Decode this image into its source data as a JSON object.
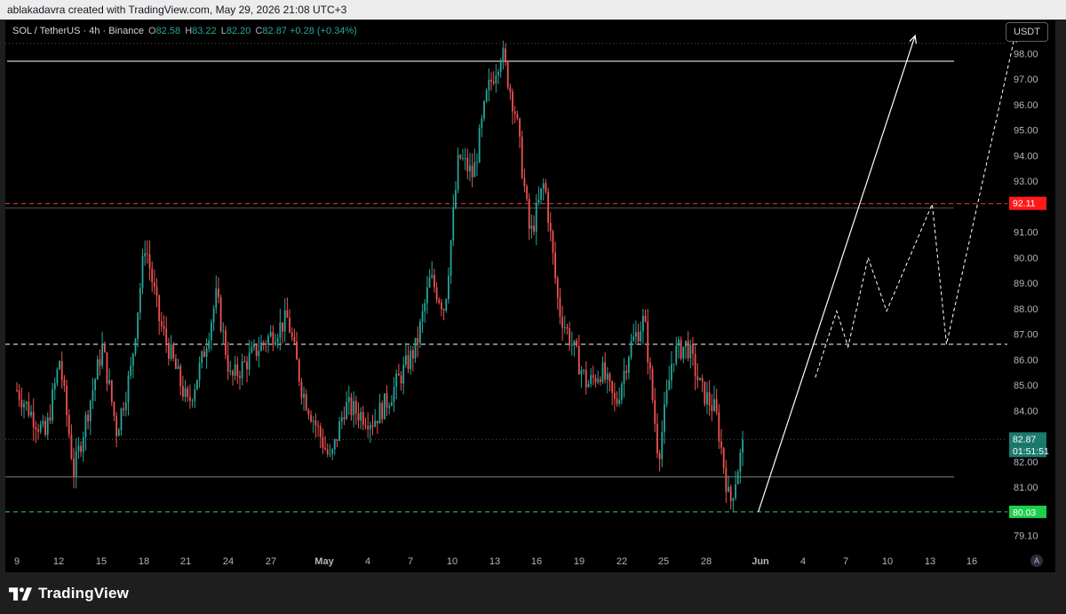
{
  "header": {
    "text": "ablakadavra created with TradingView.com, May 29, 2026 21:08 UTC+3"
  },
  "legend": {
    "symbol": "SOL / TetherUS · 4h · Binance",
    "open_label": "O",
    "open": "82.58",
    "high_label": "H",
    "high": "83.22",
    "low_label": "L",
    "low": "82.20",
    "close_label": "C",
    "close": "82.87",
    "change": "+0.28 (+0.34%)"
  },
  "currency_button": "USDT",
  "auto_scale_button": "A",
  "footer": {
    "brand": "TradingView"
  },
  "colors": {
    "up": "#26a69a",
    "down": "#ef5350",
    "background": "#000000",
    "axis_text": "#b2b5be",
    "resistance": "#ff3333",
    "support": "#39d353"
  },
  "chart_data": {
    "type": "candlestick",
    "title": "SOL / TetherUS · 4h · Binance",
    "xlabel": "",
    "ylabel": "",
    "ylim": [
      78.6,
      99.3
    ],
    "y_ticks": [
      "98.00",
      "97.00",
      "96.00",
      "95.00",
      "94.00",
      "93.00",
      "91.00",
      "90.00",
      "89.00",
      "88.00",
      "87.00",
      "86.00",
      "85.00",
      "84.00",
      "82.00",
      "81.00",
      "80.00",
      "79.10"
    ],
    "x_ticks": [
      "9",
      "12",
      "15",
      "18",
      "21",
      "24",
      "27",
      "May",
      "4",
      "7",
      "10",
      "13",
      "16",
      "19",
      "22",
      "25",
      "28",
      "Jun",
      "4",
      "7",
      "10",
      "13",
      "16"
    ],
    "x_range_days": [
      "Apr 8",
      "Jun 18"
    ],
    "price_path_approx": [
      {
        "date": "Apr 8",
        "price": 84.8
      },
      {
        "date": "Apr 10",
        "price": 83.0
      },
      {
        "date": "Apr 11",
        "price": 86.0
      },
      {
        "date": "Apr 12",
        "price": 81.6
      },
      {
        "date": "Apr 14",
        "price": 86.5
      },
      {
        "date": "Apr 15",
        "price": 83.2
      },
      {
        "date": "Apr 16",
        "price": 85.6
      },
      {
        "date": "Apr 17",
        "price": 90.6
      },
      {
        "date": "Apr 18",
        "price": 87.5
      },
      {
        "date": "Apr 20",
        "price": 84.2
      },
      {
        "date": "Apr 21",
        "price": 86.0
      },
      {
        "date": "Apr 22",
        "price": 88.5
      },
      {
        "date": "Apr 23",
        "price": 85.2
      },
      {
        "date": "Apr 25",
        "price": 86.5
      },
      {
        "date": "Apr 27",
        "price": 87.6
      },
      {
        "date": "Apr 28",
        "price": 84.8
      },
      {
        "date": "Apr 30",
        "price": 82.0
      },
      {
        "date": "May 1",
        "price": 84.2
      },
      {
        "date": "May 3",
        "price": 83.6
      },
      {
        "date": "May 4",
        "price": 84.4
      },
      {
        "date": "May 6",
        "price": 86.5
      },
      {
        "date": "May 7",
        "price": 89.2
      },
      {
        "date": "May 8",
        "price": 88.0
      },
      {
        "date": "May 9",
        "price": 94.0
      },
      {
        "date": "May 10",
        "price": 93.2
      },
      {
        "date": "May 11",
        "price": 96.5
      },
      {
        "date": "May 12",
        "price": 98.1
      },
      {
        "date": "May 13",
        "price": 95.6
      },
      {
        "date": "May 14",
        "price": 90.8
      },
      {
        "date": "May 15",
        "price": 93.0
      },
      {
        "date": "May 16",
        "price": 88.0
      },
      {
        "date": "May 17",
        "price": 86.5
      },
      {
        "date": "May 18",
        "price": 85.0
      },
      {
        "date": "May 19",
        "price": 85.6
      },
      {
        "date": "May 20",
        "price": 84.2
      },
      {
        "date": "May 21",
        "price": 86.5
      },
      {
        "date": "May 22",
        "price": 87.6
      },
      {
        "date": "May 23",
        "price": 82.2
      },
      {
        "date": "May 24",
        "price": 86.2
      },
      {
        "date": "May 25",
        "price": 86.6
      },
      {
        "date": "May 26",
        "price": 84.8
      },
      {
        "date": "May 27",
        "price": 84.0
      },
      {
        "date": "May 28",
        "price": 80.3
      },
      {
        "date": "May 29",
        "price": 82.87
      }
    ],
    "horizontal_levels": [
      {
        "price": 97.7,
        "style": "solid",
        "color": "#ffffff"
      },
      {
        "price": 98.4,
        "style": "dotted",
        "color": "#555555"
      },
      {
        "price": 92.11,
        "style": "dashed",
        "color": "#ff3333"
      },
      {
        "price": 91.95,
        "style": "solid",
        "color": "#555555"
      },
      {
        "price": 86.6,
        "style": "dashed",
        "color": "#ffffff"
      },
      {
        "price": 82.87,
        "style": "dotted",
        "color": "#555555"
      },
      {
        "price": 81.4,
        "style": "solid",
        "color": "#777777"
      },
      {
        "price": 80.03,
        "style": "dashed",
        "color": "#39d353"
      }
    ],
    "projection_arrow": [
      {
        "date": "May 30",
        "price": 80.03
      },
      {
        "date": "Jun 10",
        "price": 98.7
      }
    ],
    "projection_path": [
      {
        "date": "Jun 3",
        "price": 85.3
      },
      {
        "date": "Jun 4.5",
        "price": 87.9
      },
      {
        "date": "Jun 5.3",
        "price": 86.5
      },
      {
        "date": "Jun 6.7",
        "price": 90.0
      },
      {
        "date": "Jun 8",
        "price": 87.9
      },
      {
        "date": "Jun 11.2",
        "price": 92.1
      },
      {
        "date": "Jun 12.2",
        "price": 86.6
      },
      {
        "date": "Jun 17",
        "price": 98.7
      }
    ],
    "price_labels": [
      {
        "text": "92.11",
        "price": 92.11,
        "color": "#ff1a1a"
      },
      {
        "text": "82.87",
        "price": 82.87,
        "color": "#1b7a6e"
      },
      {
        "text": "01:51:51",
        "price": 82.87,
        "color": "#1b7a6e"
      },
      {
        "text": "80.03",
        "price": 80.03,
        "color": "#1fcf4a"
      }
    ]
  }
}
